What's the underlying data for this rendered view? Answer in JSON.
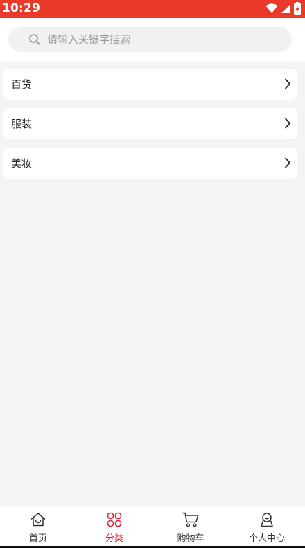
{
  "status_bar": {
    "time": "10:29"
  },
  "search": {
    "placeholder": "请输入关键字搜索"
  },
  "categories": [
    {
      "label": "百货"
    },
    {
      "label": "服装"
    },
    {
      "label": "美妆"
    }
  ],
  "tabbar": {
    "tabs": [
      {
        "label": "首页",
        "icon": "home-icon",
        "active": false
      },
      {
        "label": "分类",
        "icon": "grid-icon",
        "active": true
      },
      {
        "label": "购物车",
        "icon": "cart-icon",
        "active": false
      },
      {
        "label": "个人中心",
        "icon": "user-icon",
        "active": false
      }
    ]
  },
  "colors": {
    "status_bar": "#e8392b",
    "active_tab": "#e0243a"
  }
}
